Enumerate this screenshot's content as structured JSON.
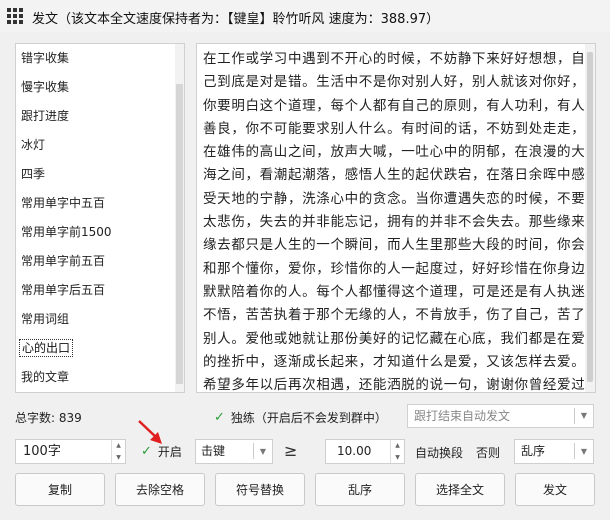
{
  "window": {
    "title": "发文（该文本全文速度保持者为：【键皇】聆竹听风 速度为：388.97）"
  },
  "sidebar": {
    "items": [
      {
        "label": "错字收集"
      },
      {
        "label": "慢字收集"
      },
      {
        "label": "跟打进度"
      },
      {
        "label": "冰灯"
      },
      {
        "label": "四季"
      },
      {
        "label": "常用单字中五百"
      },
      {
        "label": "常用单字前1500"
      },
      {
        "label": "常用单字前五百"
      },
      {
        "label": "常用单字后五百"
      },
      {
        "label": "常用词组"
      },
      {
        "label": "心的出口"
      },
      {
        "label": "我的文章"
      }
    ],
    "selected": "心的出口"
  },
  "content": {
    "text": "在工作或学习中遇到不开心的时候，不妨静下来好好想想，自己到底是对是错。生活中不是你对别人好，别人就该对你好，你要明白这个道理，每个人都有自己的原则，有人功利，有人善良，你不可能要求别人什么。有时间的话，不妨到处走走，在雄伟的高山之间，放声大喊，一吐心中的阴郁，在浪漫的大海之间，看潮起潮落，感悟人生的起伏跌宕，在落日余晖中感受天地的宁静，洗涤心中的贪念。当你遭遇失恋的时候，不要太悲伤，失去的并非能忘记，拥有的并非不会失去。那些缘来缘去都只是人生的一个瞬间，而人生里那些大段的时间，你会和那个懂你，爱你，珍惜你的人一起度过，好好珍惜在你身边默默陪着你的人。每个人都懂得这个道理，可是还是有人执迷不悟，苦苦执着于那个无缘的人，不肯放手，伤了自己，苦了别人。爱他或她就让那份美好的记忆藏在心底，我们都是在爱的挫折中，逐渐成长起来，才知道什么是爱，又该怎样去爱。希望多年以后再次相遇，还能洒脱的说一句，谢谢你曾经爱过我。当你的婚姻出现问题的时候，多些宽容，多些理解，少些责骂。婚姻本来就是两个人的事，一味的埋怨对方，根本不能解决任何问题。多想想曾经的美好回忆，想想两人同吃一碗面的艰难日子，想想曾经心里的感动。试着做一下换位思考，自己错在哪"
  },
  "status": {
    "total_label": "总字数: 839",
    "solo_label": "独练（开启后不会发到群中）",
    "solo_checked": true,
    "auto_placeholder": "跟打结束自动发文"
  },
  "controls": {
    "chunk_size": "100字",
    "open_label": "开启",
    "open_checked": true,
    "key_mode": "击键",
    "ge_symbol": "≥",
    "threshold": "10.00",
    "auto_next_label": "自动换段",
    "else_label": "否则",
    "else_action": "乱序"
  },
  "buttons": {
    "copy": "复制",
    "remove_spaces": "去除空格",
    "symbol_replace": "符号替换",
    "shuffle": "乱序",
    "select_all": "选择全文",
    "send": "发文"
  },
  "colors": {
    "check_green": "#2a9d3a",
    "annotation_red": "#e02020"
  }
}
